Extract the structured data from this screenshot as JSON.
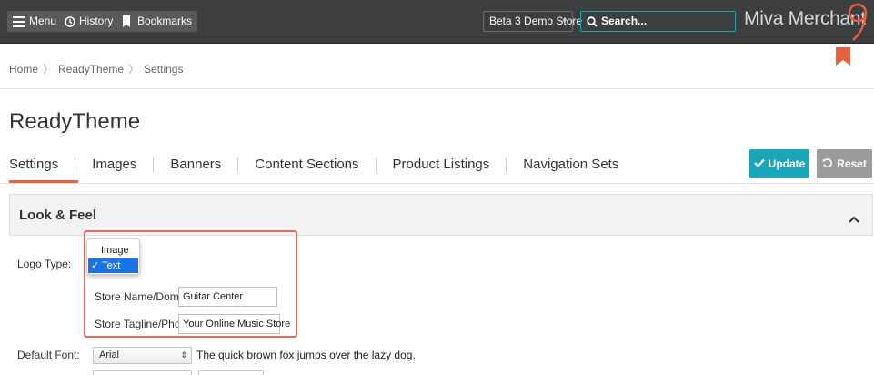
{
  "topbar": {
    "menu_label": "Menu",
    "history_label": "History",
    "bookmarks_label": "Bookmarks",
    "store_selected": "Beta 3 Demo Store",
    "search_placeholder": "Search...",
    "brand": "Miva Merchant"
  },
  "breadcrumb": [
    "Home",
    "ReadyTheme",
    "Settings"
  ],
  "page_title": "ReadyTheme",
  "tabs": [
    "Settings",
    "Images",
    "Banners",
    "Content Sections",
    "Product Listings",
    "Navigation Sets"
  ],
  "active_tab": "Settings",
  "actions": {
    "update_label": "Update",
    "reset_label": "Reset"
  },
  "section": {
    "title": "Look & Feel"
  },
  "form": {
    "logo_type_label": "Logo Type:",
    "logo_type_options": [
      "Image",
      "Text"
    ],
    "logo_type_selected": "Text",
    "store_name_label": "Store Name/Domain:",
    "store_name_value": "Guitar Center",
    "store_tagline_label": "Store Tagline/Phone:",
    "store_tagline_value": "Your Online Music Store",
    "default_font_label": "Default Font:",
    "default_font_value": "Arial",
    "font_sample_text": "The quick brown fox jumps over the lazy dog."
  },
  "colors": {
    "topbar_bg": "#3d3e40",
    "accent_teal": "#1aa5b8",
    "accent_orange": "#e8603c",
    "reset_gray": "#9a9b9d",
    "highlight_red": "#e8695c",
    "select_blue": "#1a73e8"
  }
}
